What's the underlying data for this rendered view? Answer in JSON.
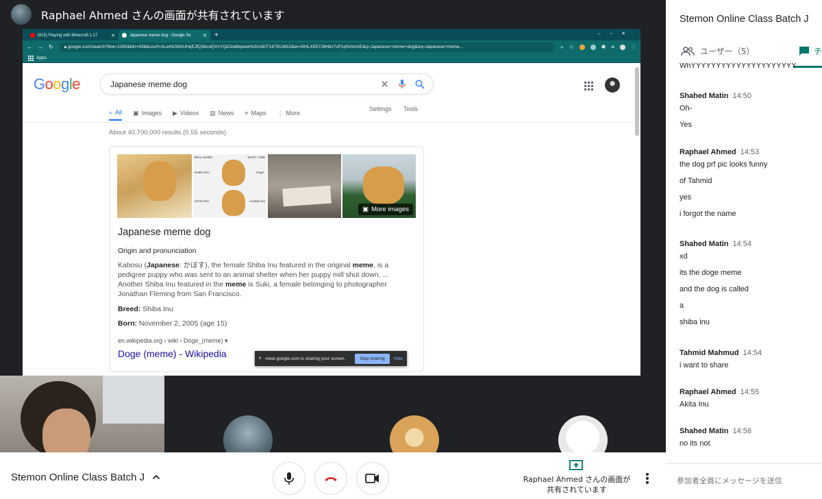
{
  "presenter": {
    "name_label": "Raphael Ahmed さんの画面が共有されています"
  },
  "browser": {
    "tabs": [
      {
        "label": "(815) Playing with Minecraft 1.17",
        "icon": "youtube-icon"
      },
      {
        "label": "Japanese meme dog - Google Se",
        "icon": "google-icon"
      }
    ],
    "new_tab": "+",
    "url": "google.com/search?biw=1280&bih=636&sxsrf=ALeKk00kIUHqEJfQ3bcdQVzYQdJzaMqsew%3A1607147913652&ei=iSHLX9S7J8Hbz7sP1pSmmAE&q=Japanese+meme+dog&oq=Japanese+meme...",
    "bookmarks_apps": "Apps"
  },
  "google": {
    "logo_letters": [
      "G",
      "o",
      "o",
      "g",
      "l",
      "e"
    ],
    "logo_colors": [
      "#4285f4",
      "#ea4335",
      "#fbbc05",
      "#4285f4",
      "#34a853",
      "#ea4335"
    ],
    "query": "Japanese meme dog",
    "tabs": [
      {
        "label": "All",
        "icon": "search-icon",
        "active": true
      },
      {
        "label": "Images",
        "icon": "image-icon"
      },
      {
        "label": "Videos",
        "icon": "play-icon"
      },
      {
        "label": "News",
        "icon": "news-icon"
      },
      {
        "label": "Maps",
        "icon": "map-pin-icon"
      },
      {
        "label": "More",
        "icon": "more-vert-icon"
      }
    ],
    "settings_label": "Settings",
    "tools_label": "Tools",
    "stats": "About 40,700,000 results (0.55 seconds)",
    "panel": {
      "img2_texts": [
        "REAL NAME:",
        "WHAT I SEE",
        "SHIBA INU",
        "Doge",
        "AKITA INU",
        "Another Do"
      ],
      "more_images": "More images",
      "title": "Japanese meme dog",
      "subtitle": "Origin and pronunciation",
      "desc_parts": [
        "Kabosu (",
        "Japanese",
        ": かぼす), the female Shiba Inu featured in the original ",
        "meme",
        ", is a pedigree puppy who was sent to an animal shelter when her puppy mill shut down. ... Another Shiba Inu featured in the ",
        "meme",
        " is Suki, a female belonging to photographer Jonathan Fleming from San Francisco."
      ],
      "breed_label": "Breed:",
      "breed_value": " Shiba Inu",
      "born_label": "Born:",
      "born_value": " November 2, 2005 (age 15)",
      "cite": "en.wikipedia.org › wiki › Doge_(meme) ▾",
      "link": "Doge (meme) - Wikipedia"
    },
    "sharing_bar": {
      "text": "meet.google.com is sharing your screen.",
      "stop": "Stop sharing",
      "hide": "Hide"
    }
  },
  "bottom": {
    "meeting_name": "Stemon Online Class Batch J",
    "present_text": "Raphael Ahmed さんの画面が共有されています",
    "hangup_color": "#d93025"
  },
  "panel": {
    "title": "Stemon Online Class Batch J",
    "users_tab": "ユーザー（5）",
    "chat_tab": "チ",
    "accent": "#00796b",
    "partial_top": "WhYYYYYYYYYYYYYYYYYYYYY",
    "messages": [
      {
        "sender": "Shahed Matin",
        "time": "14:50",
        "lines": [
          "Oh-",
          "Yes"
        ]
      },
      {
        "sender": "Raphael Ahmed",
        "time": "14:53",
        "lines": [
          "the dog prf pic looks funny",
          "of Tahmid",
          "yes",
          "i forgot the name"
        ]
      },
      {
        "sender": "Shahed Matin",
        "time": "14:54",
        "lines": [
          "xd",
          "its the doge meme",
          "and the dog is called",
          "a",
          "shiba inu"
        ]
      },
      {
        "sender": "Tahmid Mahmud",
        "time": "14:54",
        "lines": [
          "i want to share"
        ]
      },
      {
        "sender": "Raphael Ahmed",
        "time": "14:55",
        "lines": [
          "Akita Inu"
        ]
      },
      {
        "sender": "Shahed Matin",
        "time": "14:58",
        "lines": [
          "no its not"
        ]
      }
    ],
    "input_placeholder": "参加者全員にメッセージを送信"
  }
}
